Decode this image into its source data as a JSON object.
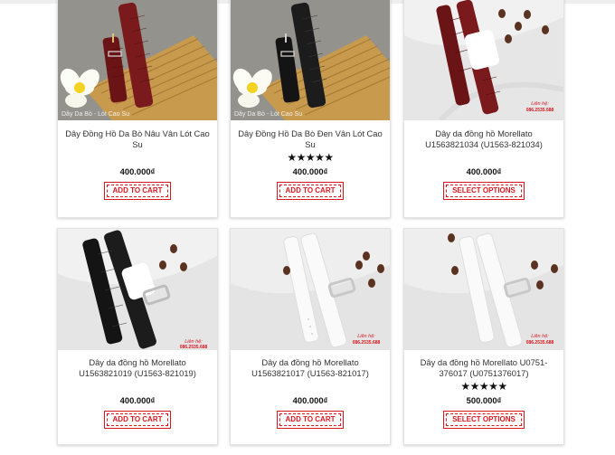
{
  "products": [
    {
      "title": "Dây Đồng Hồ Da Bò Nâu Vân Lót Cao Su",
      "price": "400.000₫",
      "stars": "",
      "button": "ADD TO CART",
      "watermark": "Dây Da Bò - Lót Cao Su",
      "seller_tag": "",
      "seller_phone": ""
    },
    {
      "title": "Dây Đồng Hồ Da Bò Đen Vân Lót Cao Su",
      "price": "400.000₫",
      "stars": "★★★★★",
      "rating": 5,
      "button": "ADD TO CART",
      "watermark": "Dây Da Bò - Lót Cao Su",
      "seller_tag": "",
      "seller_phone": ""
    },
    {
      "title": "Dây da đồng hồ Morellato U1563821034 (U1563-821034)",
      "price": "400.000₫",
      "stars": "",
      "button": "SELECT OPTIONS",
      "watermark": "",
      "seller_tag": "Liên hệ:",
      "seller_phone": "086.2535.688"
    },
    {
      "title": "Dây da đồng hồ Morellato U1563821019 (U1563-821019)",
      "price": "400.000₫",
      "stars": "",
      "button": "ADD TO CART",
      "watermark": "",
      "seller_tag": "Liên hệ:",
      "seller_phone": "086.2535.688"
    },
    {
      "title": "Dây da đồng hồ Morellato U1563821017 (U1563-821017)",
      "price": "400.000₫",
      "stars": "",
      "button": "ADD TO CART",
      "watermark": "",
      "seller_tag": "Liên hệ:",
      "seller_phone": "086.2535.688"
    },
    {
      "title": "Dây da đồng hồ Morellato U0751-376017 (U0751376017)",
      "price": "500.000₫",
      "stars": "★★★★★",
      "rating": 5,
      "button": "SELECT OPTIONS",
      "watermark": "",
      "seller_tag": "Liên hệ:",
      "seller_phone": "086.2535.688"
    }
  ],
  "colors": {
    "accent": "#d71920",
    "brown_strap": "#6b1416",
    "black_strap": "#141414",
    "white_strap": "#f7f7f7",
    "bamboo": "#c79a4e"
  }
}
